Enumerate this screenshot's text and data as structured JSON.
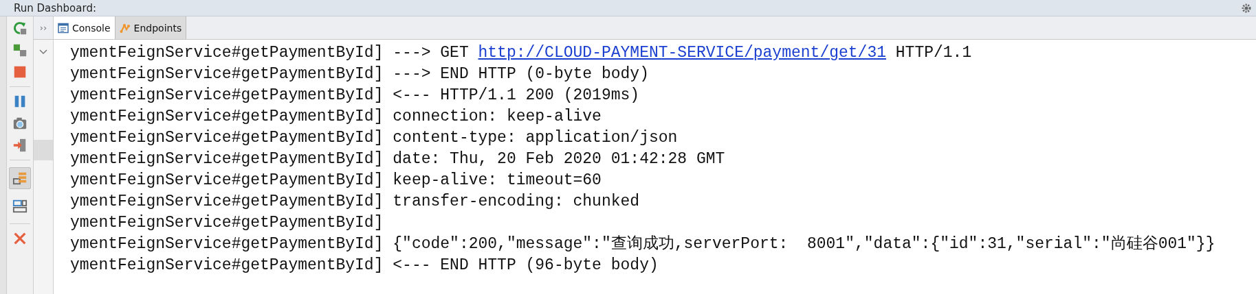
{
  "panel": {
    "title": "Run Dashboard:"
  },
  "tabs": [
    {
      "label": "Console",
      "kind": "console",
      "selected": true
    },
    {
      "label": "Endpoints",
      "kind": "endpoints",
      "selected": false
    }
  ],
  "toolbar": [
    {
      "kind": "rerun"
    },
    {
      "kind": "modules"
    },
    {
      "kind": "stop"
    },
    {
      "kind": "separator"
    },
    {
      "kind": "pause"
    },
    {
      "kind": "camera"
    },
    {
      "kind": "exit"
    },
    {
      "kind": "separator"
    },
    {
      "kind": "tree",
      "selected": true
    },
    {
      "kind": "layout",
      "selected": false
    },
    {
      "kind": "separator"
    },
    {
      "kind": "close"
    }
  ],
  "expand_toggle": "››",
  "console_lines": [
    {
      "parts": [
        {
          "kind": "text",
          "text": "ymentFeignService#getPaymentById] ---> GET "
        },
        {
          "kind": "link",
          "text": "http://CLOUD-PAYMENT-SERVICE/payment/get/31"
        },
        {
          "kind": "text",
          "text": " HTTP/1.1"
        }
      ]
    },
    {
      "parts": [
        {
          "kind": "text",
          "text": "ymentFeignService#getPaymentById] ---> END HTTP (0-byte body)"
        }
      ]
    },
    {
      "parts": [
        {
          "kind": "text",
          "text": "ymentFeignService#getPaymentById] <--- HTTP/1.1 200 (2019ms)"
        }
      ]
    },
    {
      "parts": [
        {
          "kind": "text",
          "text": "ymentFeignService#getPaymentById] connection: keep-alive"
        }
      ]
    },
    {
      "parts": [
        {
          "kind": "text",
          "text": "ymentFeignService#getPaymentById] content-type: application/json"
        }
      ]
    },
    {
      "parts": [
        {
          "kind": "text",
          "text": "ymentFeignService#getPaymentById] date: Thu, 20 Feb 2020 01:42:28 GMT"
        }
      ]
    },
    {
      "parts": [
        {
          "kind": "text",
          "text": "ymentFeignService#getPaymentById] keep-alive: timeout=60"
        }
      ]
    },
    {
      "parts": [
        {
          "kind": "text",
          "text": "ymentFeignService#getPaymentById] transfer-encoding: chunked"
        }
      ]
    },
    {
      "parts": [
        {
          "kind": "text",
          "text": "ymentFeignService#getPaymentById]"
        }
      ]
    },
    {
      "parts": [
        {
          "kind": "text",
          "text": "ymentFeignService#getPaymentById] {\"code\":200,\"message\":\"查询成功,serverPort:  8001\",\"data\":{\"id\":31,\"serial\":\"尚硅谷001\"}}"
        }
      ]
    },
    {
      "parts": [
        {
          "kind": "text",
          "text": "ymentFeignService#getPaymentById] <--- END HTTP (96-byte body)"
        }
      ]
    }
  ]
}
